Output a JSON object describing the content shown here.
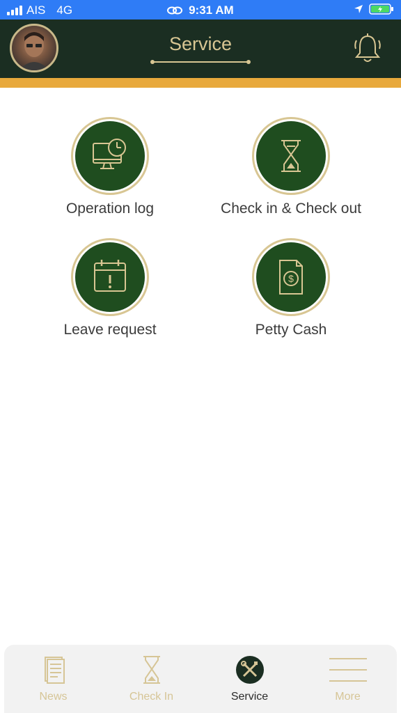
{
  "status_bar": {
    "carrier": "AIS",
    "network": "4G",
    "time": "9:31 AM"
  },
  "header": {
    "title": "Service"
  },
  "services": [
    {
      "label": "Operation log",
      "icon": "monitor-clock-icon"
    },
    {
      "label": "Check in & Check out",
      "icon": "hourglass-icon"
    },
    {
      "label": "Leave request",
      "icon": "calendar-alert-icon"
    },
    {
      "label": "Petty Cash",
      "icon": "dollar-document-icon"
    }
  ],
  "tabs": [
    {
      "label": "News",
      "icon": "newspaper-icon",
      "active": false
    },
    {
      "label": "Check In",
      "icon": "hourglass-icon",
      "active": false
    },
    {
      "label": "Service",
      "icon": "tools-icon",
      "active": true
    },
    {
      "label": "More",
      "icon": "menu-icon",
      "active": false
    }
  ],
  "colors": {
    "status_bar": "#2f7cf6",
    "header_bg": "#1b2e22",
    "accent_orange": "#e8a93c",
    "gold": "#d8c693",
    "icon_green": "#1f4d1f"
  }
}
